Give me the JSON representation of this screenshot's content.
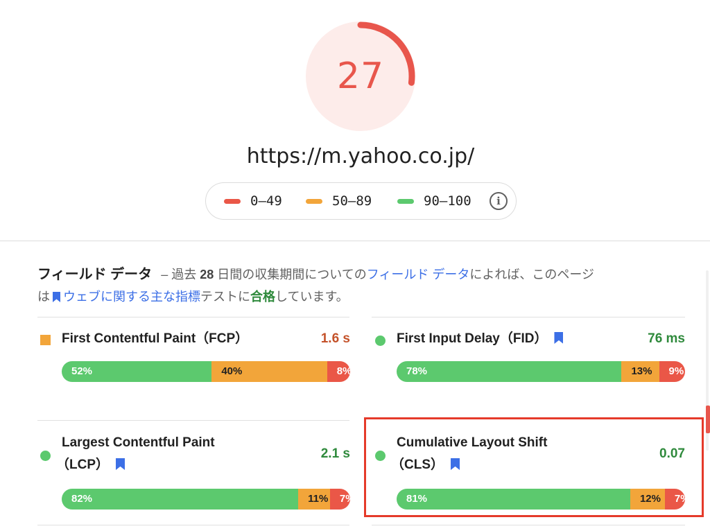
{
  "score": {
    "value": "27",
    "fraction": 0.27,
    "color": "#e8564c"
  },
  "url": "https://m.yahoo.co.jp/",
  "legend": [
    {
      "label": "0–49",
      "color": "#ea5747"
    },
    {
      "label": "50–89",
      "color": "#f2a53a"
    },
    {
      "label": "90–100",
      "color": "#5cc96e"
    }
  ],
  "legend_info_icon": "info-icon",
  "field_data": {
    "title": "フィールド データ",
    "dash": "–",
    "text1": "過去",
    "days": "28",
    "text2": "日間の収集期間についての",
    "link1": "フィールド データ",
    "text3": "によれば、このページ",
    "text4": "は",
    "link2": "ウェブに関する主な指標",
    "text5": "テストに",
    "result": "合格",
    "text6": "しています。"
  },
  "metrics": [
    {
      "name": "First Contentful Paint（FCP）",
      "value": "1.6 s",
      "status": "average",
      "value_color": "#c4522a",
      "segments": [
        {
          "label": "52%",
          "pct": 52
        },
        {
          "label": "40%",
          "pct": 40
        },
        {
          "label": "8%",
          "pct": 8
        }
      ]
    },
    {
      "name": "First Input Delay（FID）",
      "value": "76 ms",
      "status": "good",
      "value_color": "#2f8a3c",
      "segments": [
        {
          "label": "78%",
          "pct": 78
        },
        {
          "label": "13%",
          "pct": 13
        },
        {
          "label": "9%",
          "pct": 9
        }
      ]
    },
    {
      "name_line1": "Largest Contentful Paint",
      "name_line2": "（LCP）",
      "value": "2.1 s",
      "status": "good",
      "value_color": "#2f8a3c",
      "segments": [
        {
          "label": "82%",
          "pct": 82
        },
        {
          "label": "11%",
          "pct": 11
        },
        {
          "label": "7%",
          "pct": 7
        }
      ]
    },
    {
      "name_line1": "Cumulative Layout Shift",
      "name_line2": "（CLS）",
      "value": "0.07",
      "status": "good",
      "value_color": "#2f8a3c",
      "segments": [
        {
          "label": "81%",
          "pct": 81
        },
        {
          "label": "12%",
          "pct": 12
        },
        {
          "label": "7%",
          "pct": 7
        }
      ]
    }
  ]
}
